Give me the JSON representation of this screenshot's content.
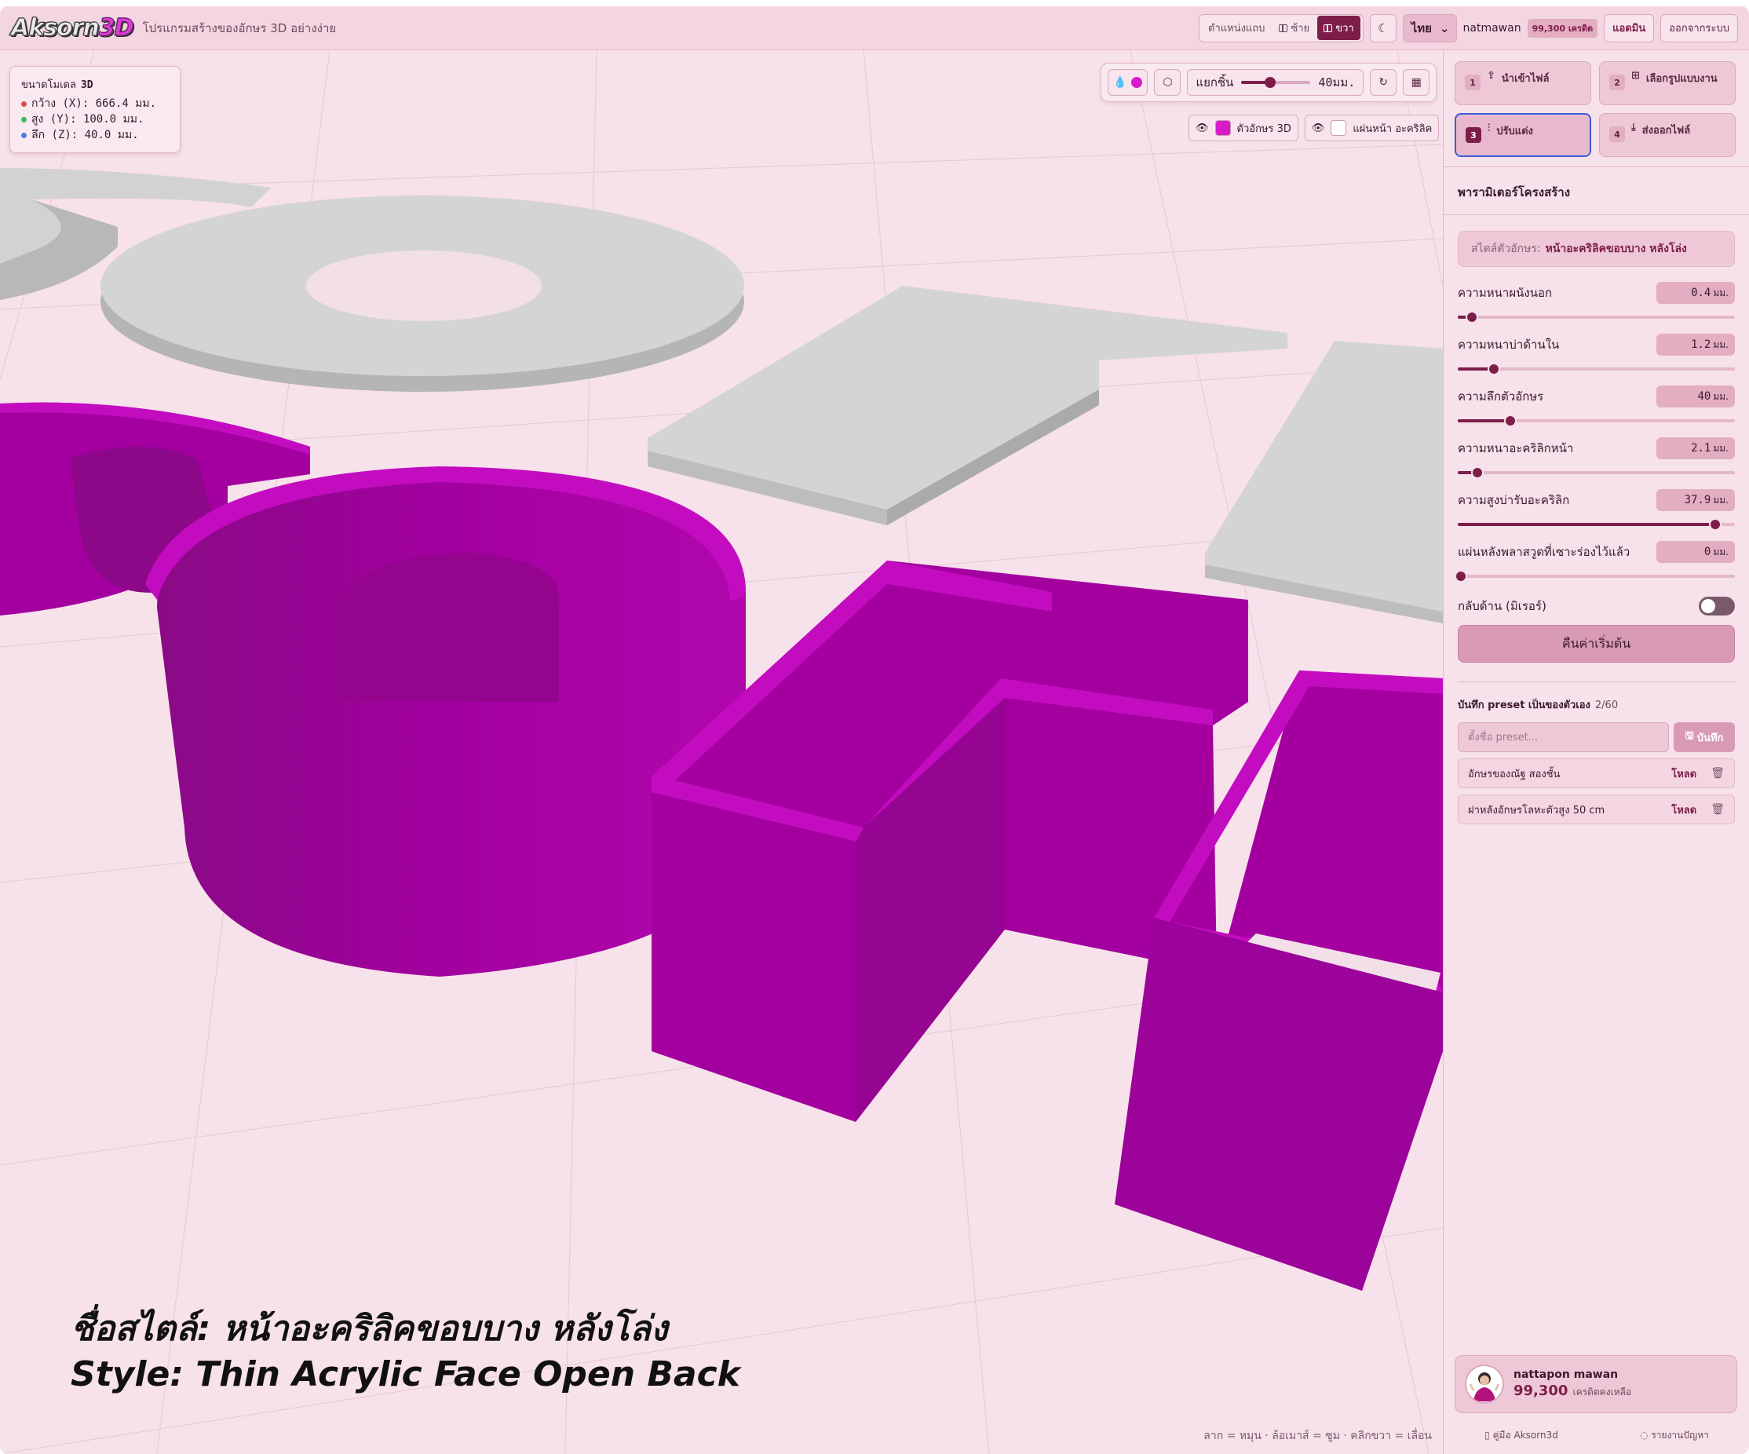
{
  "header": {
    "logo_main": "Aksorn",
    "logo_accent": "3D",
    "tagline": "โปรแกรมสร้างของอักษร 3D อย่างง่าย",
    "position_label": "ตำแหน่งแถบ",
    "position_left": "ซ้าย",
    "position_right": "ขวา",
    "theme_icon": "moon-icon",
    "language": "ไทย",
    "username": "natmawan",
    "credits_badge": "99,300 เครดิต",
    "admin_button": "แอดมิน",
    "logout_button": "ออกจากระบบ"
  },
  "viewport": {
    "dims": {
      "title": "ขนาดโมเดล",
      "title_bold": "3D",
      "width": "กว้าง (X): 666.4 มม.",
      "height": "สูง (Y): 100.0 มม.",
      "depth": "ลึก (Z): 40.0 มม.",
      "colors": {
        "x": "#e0484e",
        "y": "#3cb95a",
        "z": "#4a7ae8"
      }
    },
    "toolbar": {
      "separate_label": "แยกชิ้น",
      "separate_value": "40มม.",
      "separate_fraction": 0.4,
      "accent_color": "#d81bc8"
    },
    "layers": {
      "letters_label": "ตัวอักษร 3D",
      "letters_color": "#d81bc8",
      "acrylic_label": "แผ่นหน้า อะคริลิค",
      "acrylic_color": "#ffffff"
    },
    "caption_th": "ชื่อสไตล์: หน้าอะคริลิคขอบบาง หลังโล่ง",
    "caption_en": "Style: Thin Acrylic Face Open Back",
    "hint": "ลาก = หมุน · ล้อเมาส์ = ซูม · คลิกขวา = เลื่อน"
  },
  "sidebar": {
    "steps": [
      {
        "num": "1",
        "label": "นำเข้าไฟล์"
      },
      {
        "num": "2",
        "label": "เลือกรูปแบบงาน"
      },
      {
        "num": "3",
        "label": "ปรับแต่ง"
      },
      {
        "num": "4",
        "label": "ส่งออกไฟล์"
      }
    ],
    "section_title": "พารามิเตอร์โครงสร้าง",
    "style_label": "สไตล์ตัวอักษร:",
    "style_value": "หน้าอะคริลิคขอบบาง หลังโล่ง",
    "params": [
      {
        "name": "ความหนาผนังนอก",
        "value": "0.4",
        "unit": "มม.",
        "fraction": 0.05
      },
      {
        "name": "ความหนาบ่าด้านใน",
        "value": "1.2",
        "unit": "มม.",
        "fraction": 0.13
      },
      {
        "name": "ความลึกตัวอักษร",
        "value": "40",
        "unit": "มม.",
        "fraction": 0.19
      },
      {
        "name": "ความหนาอะคริลิกหน้า",
        "value": "2.1",
        "unit": "มม.",
        "fraction": 0.07
      },
      {
        "name": "ความสูงบ่ารับอะคริลิก",
        "value": "37.9",
        "unit": "มม.",
        "fraction": 0.93
      },
      {
        "name": "แผ่นหลังพลาสวูดที่เซาะร่องไว้แล้ว",
        "value": "0",
        "unit": "มม.",
        "fraction": 0.0
      }
    ],
    "mirror_label": "กลับด้าน (มิเรอร์)",
    "reset_button": "คืนค่าเริ่มต้น",
    "preset_title": "บันทึก preset เป็นของตัวเอง",
    "preset_count": "2/60",
    "preset_placeholder": "ตั้งชื่อ preset...",
    "save_button": "บันทึก",
    "presets": [
      {
        "name": "อักษรของณัฐ สองชั้น",
        "load": "โหลด"
      },
      {
        "name": "ฝาหลังอักษรโลหะตัวสูง 50 cm",
        "load": "โหลด"
      }
    ],
    "user_card": {
      "name": "nattapon mawan",
      "credits": "99,300",
      "credits_label": "เครดิตคงเหลือ"
    },
    "footer": {
      "manual": "คู่มือ Aksorn3d",
      "report": "รายงานปัญหา"
    }
  }
}
